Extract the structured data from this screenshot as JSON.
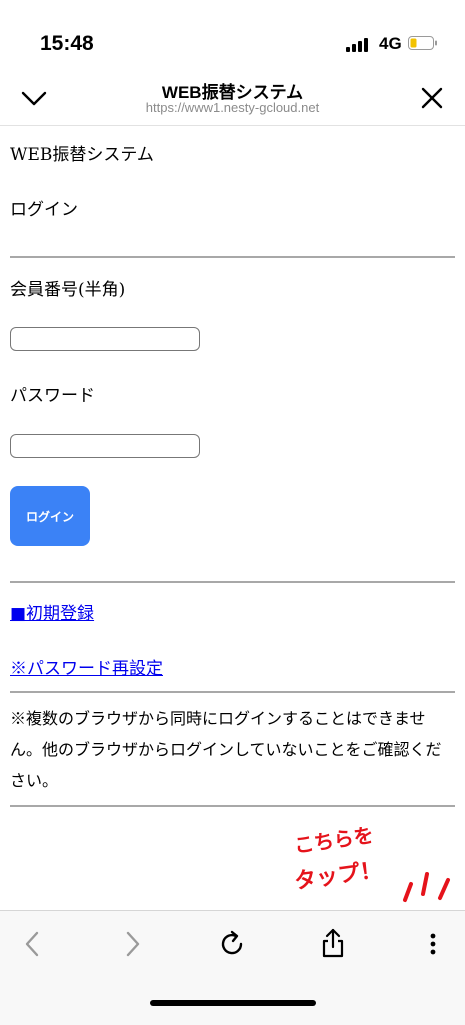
{
  "status_bar": {
    "time": "15:48",
    "network": "4G"
  },
  "nav": {
    "title": "WEB振替システム",
    "url": "https://www1.nesty-gcloud.net"
  },
  "page": {
    "heading": "WEB振替システム",
    "subheading": "ログイン",
    "member_no_label": "会員番号(半角)",
    "member_no_value": "",
    "password_label": "パスワード",
    "password_value": "",
    "login_button": "ログイン",
    "initial_registration_link": "■初期登録",
    "password_reset_link": "※パスワード再設定",
    "notice": "※複数のブラウザから同時にログインすることはできません。他のブラウザからログインしていないことをご確認ください。"
  },
  "annotation": {
    "line1": "こちらを",
    "line2": "タップ！",
    "color": "#e5131b"
  },
  "colors": {
    "accent": "#3b82f6",
    "link": "#0000ee"
  },
  "toolbar_icons": [
    "back-icon",
    "forward-icon",
    "reload-icon",
    "share-icon",
    "more-icon"
  ]
}
